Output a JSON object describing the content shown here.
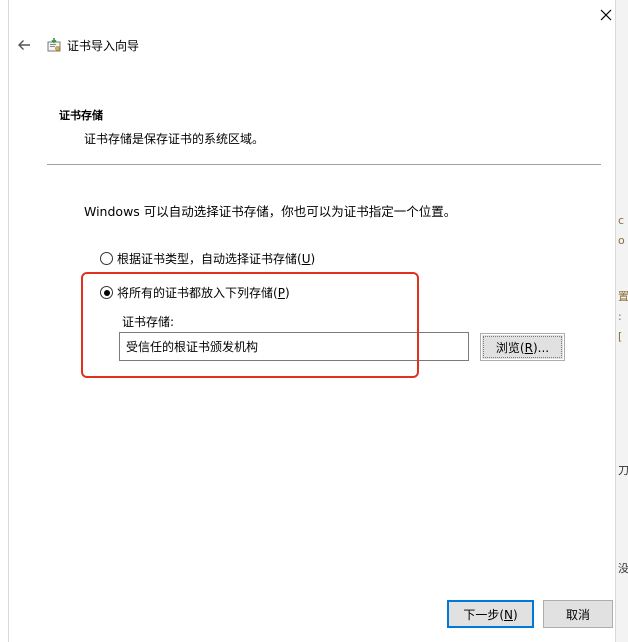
{
  "wizard": {
    "title": "证书导入向导",
    "icon": "certificate-import-icon"
  },
  "header": {
    "section_title": "证书存储",
    "section_description": "证书存储是保存证书的系统区域。"
  },
  "body": {
    "info_text": "Windows 可以自动选择证书存储，你也可以为证书指定一个位置。",
    "options": [
      {
        "label_prefix": "根据证书类型，自动选择证书存储(",
        "accesskey": "U",
        "label_suffix": ")",
        "checked": false
      },
      {
        "label_prefix": "将所有的证书都放入下列存储(",
        "accesskey": "P",
        "label_suffix": ")",
        "checked": true
      }
    ],
    "store_label": "证书存储:",
    "store_value": "受信任的根证书颁发机构",
    "browse": {
      "prefix": "浏览(",
      "accesskey": "R",
      "suffix": ")..."
    }
  },
  "footer": {
    "next": {
      "prefix": "下一步(",
      "accesskey": "N",
      "suffix": ")"
    },
    "cancel": "取消"
  },
  "colors": {
    "highlight_border": "#e0301e",
    "default_button_border": "#0078d7",
    "button_face": "#e1e1e1"
  }
}
